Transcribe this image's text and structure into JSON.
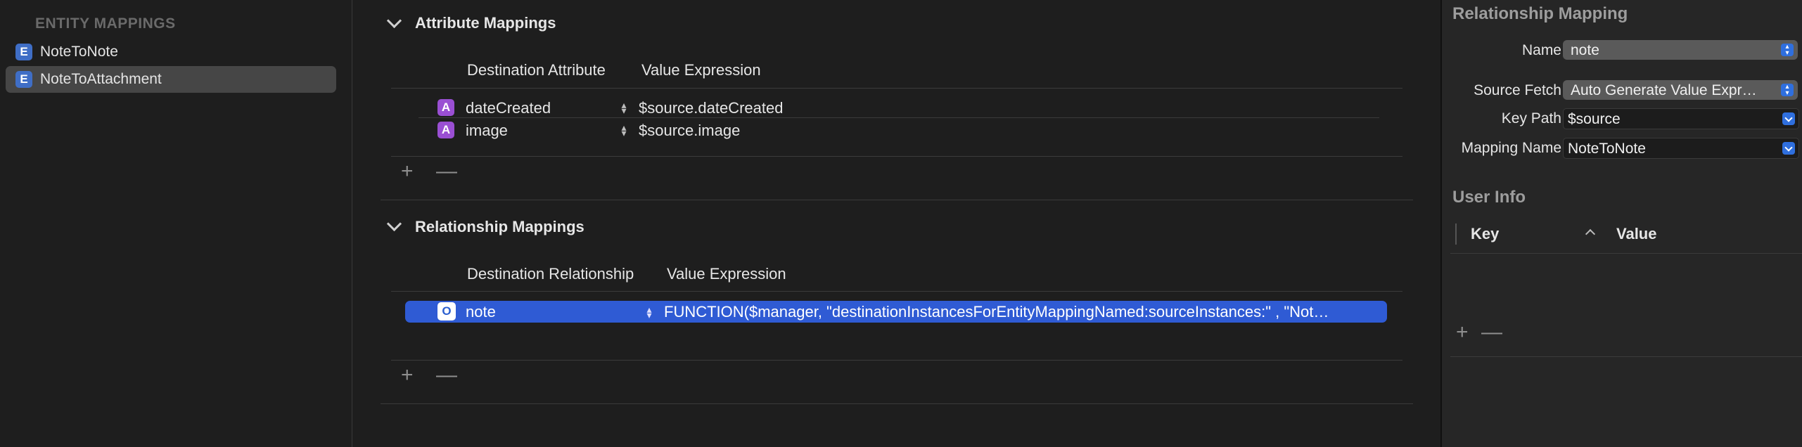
{
  "sidebar": {
    "header": "ENTITY MAPPINGS",
    "items": [
      {
        "badge": "E",
        "label": "NoteToNote"
      },
      {
        "badge": "E",
        "label": "NoteToAttachment"
      }
    ]
  },
  "attributes": {
    "title": "Attribute Mappings",
    "col_destination": "Destination Attribute",
    "col_value": "Value Expression",
    "rows": [
      {
        "badge": "A",
        "name": "dateCreated",
        "expression": "$source.dateCreated"
      },
      {
        "badge": "A",
        "name": "image",
        "expression": "$source.image"
      }
    ],
    "add": "+",
    "remove": "—"
  },
  "relationships": {
    "title": "Relationship Mappings",
    "col_destination": "Destination Relationship",
    "col_value": "Value Expression",
    "rows": [
      {
        "badge": "O",
        "name": "note",
        "expression": "FUNCTION($manager, \"destinationInstancesForEntityMappingNamed:sourceInstances:\" , \"Not…"
      }
    ],
    "add": "+",
    "remove": "—"
  },
  "inspector": {
    "title": "Relationship Mapping",
    "name_label": "Name",
    "name_value": "note",
    "source_fetch_label": "Source Fetch",
    "source_fetch_value": "Auto Generate Value Expr…",
    "key_path_label": "Key Path",
    "key_path_value": "$source",
    "mapping_name_label": "Mapping Name",
    "mapping_name_value": "NoteToNote",
    "user_info_title": "User Info",
    "col_key": "Key",
    "col_value": "Value",
    "add": "+",
    "remove": "—"
  },
  "colors": {
    "accent": "#2f5bd4",
    "entity_badge": "#3f6ec6",
    "attribute_badge": "#9a4fd3"
  }
}
